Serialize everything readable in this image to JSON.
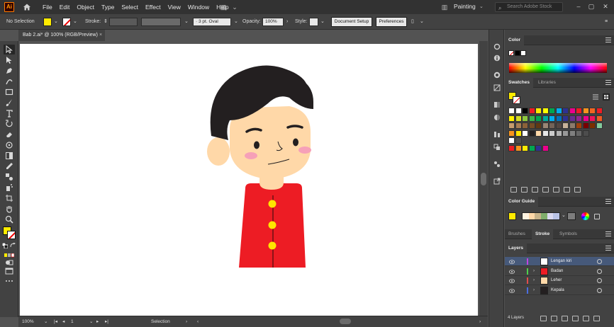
{
  "menubar": {
    "logo": "Ai",
    "items": [
      "File",
      "Edit",
      "Object",
      "Type",
      "Select",
      "Effect",
      "View",
      "Window",
      "Help"
    ],
    "workspace": "Painting",
    "search_placeholder": "Search Adobe Stock"
  },
  "control_bar": {
    "selection": "No Selection",
    "stroke_label": "Stroke:",
    "brush": "3 pt. Oval",
    "opacity_label": "Opacity:",
    "opacity_value": "100%",
    "style_label": "Style:",
    "document_setup": "Document Setup",
    "preferences": "Preferences"
  },
  "document_tab": {
    "title": "Bab 2.ai* @ 100% (RGB/Preview)",
    "close": "×"
  },
  "status_bar": {
    "zoom": "100%",
    "artboard": "1",
    "tool": "Selection"
  },
  "panels": {
    "color": {
      "title": "Color"
    },
    "swatches": {
      "tabs": [
        "Swatches",
        "Libraries"
      ]
    },
    "color_guide": {
      "title": "Color Guide"
    },
    "stroke_tabs": [
      "Brushes",
      "Stroke",
      "Symbols"
    ],
    "layers": {
      "title": "Layers",
      "items": [
        {
          "name": "Lengan kiri",
          "color": "#c144e0",
          "selected": true,
          "has_children": false
        },
        {
          "name": "Badan",
          "color": "#4cd04c",
          "selected": false,
          "has_children": true
        },
        {
          "name": "Leher",
          "color": "#e24b4b",
          "selected": false,
          "has_children": true
        },
        {
          "name": "Kepala",
          "color": "#4a6de0",
          "selected": false,
          "has_children": true
        }
      ],
      "count": "4 Layers"
    }
  },
  "colors": {
    "skin": "#ffd8a8",
    "hair": "#231f20",
    "shirt": "#ed1c24",
    "button": "#ffe600",
    "blush": "#f6a0b8",
    "fill": "#ffeb00"
  }
}
